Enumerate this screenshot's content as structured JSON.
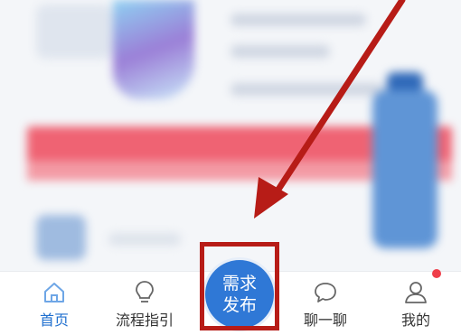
{
  "tabs": [
    {
      "label": "首页",
      "icon": "home-icon",
      "active": true
    },
    {
      "label": "流程指引",
      "icon": "lightbulb-icon",
      "active": false
    },
    {
      "label": "聊一聊",
      "icon": "chat-bubble-icon",
      "active": false
    },
    {
      "label": "我的",
      "icon": "user-icon",
      "active": false
    }
  ],
  "publish": {
    "line1": "需求",
    "line2": "发布"
  },
  "colors": {
    "accent": "#2f78d6",
    "annotation": "#b71c17",
    "badge": "#ef3e4a"
  }
}
